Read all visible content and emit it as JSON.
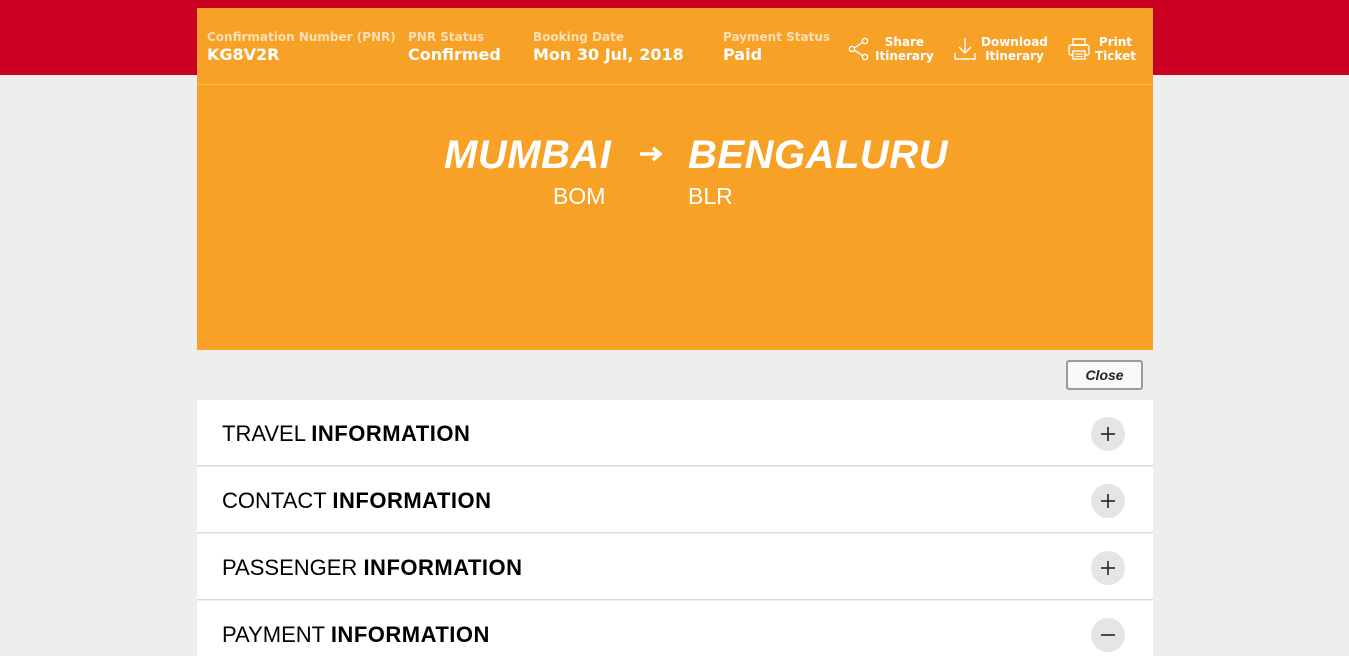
{
  "header": {
    "pnr_label": "Confirmation Number (PNR)",
    "pnr_value": "KG8V2R",
    "status_label": "PNR Status",
    "status_value": "Confirmed",
    "booking_label": "Booking Date",
    "booking_value": "Mon 30 Jul, 2018",
    "payment_label": "Payment Status",
    "payment_value": "Paid",
    "actions": [
      {
        "line1": "Share",
        "line2": "Itinerary",
        "icon": "share-icon"
      },
      {
        "line1": "Download",
        "line2": "Itinerary",
        "icon": "download-icon"
      },
      {
        "line1": "Print",
        "line2": "Ticket",
        "icon": "print-icon"
      }
    ]
  },
  "route": {
    "origin_city": "MUMBAI",
    "origin_code": "BOM",
    "destination_city": "BENGALURU",
    "destination_code": "BLR",
    "arrow_icon": "arrow-right-icon"
  },
  "close_label": "Close",
  "sections": [
    {
      "prefix": "TRAVEL",
      "bold": "INFORMATION",
      "state": "+"
    },
    {
      "prefix": "CONTACT",
      "bold": "INFORMATION",
      "state": "+"
    },
    {
      "prefix": "PASSENGER",
      "bold": "INFORMATION",
      "state": "+"
    },
    {
      "prefix": "PAYMENT",
      "bold": "INFORMATION",
      "state": "−"
    }
  ],
  "colors": {
    "brand_red": "#cc0022",
    "card_orange": "#f7a127",
    "page_bg": "#efeeee"
  }
}
